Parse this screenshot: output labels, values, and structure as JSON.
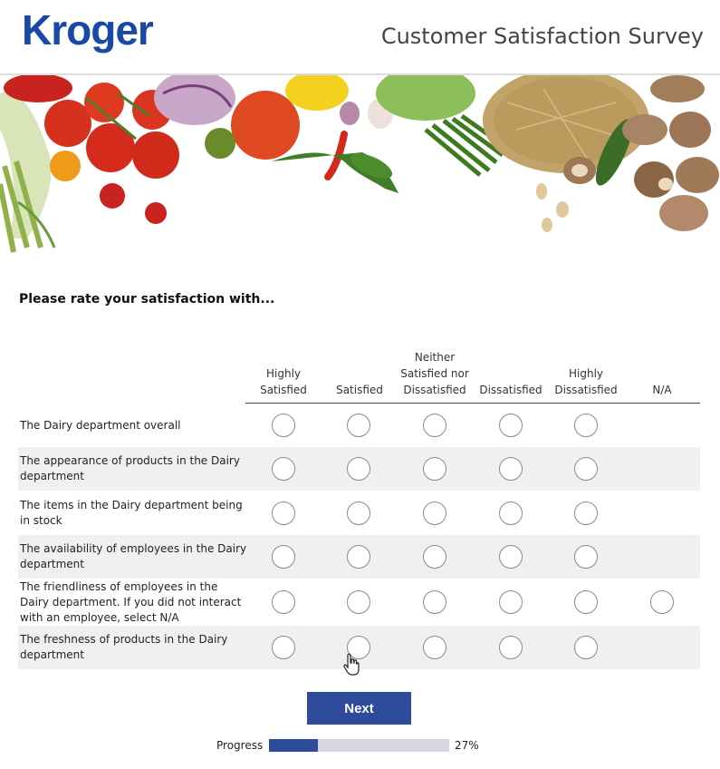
{
  "header": {
    "logo_text": "Kroger",
    "title": "Customer Satisfaction Survey",
    "brand_color": "#1a48a8"
  },
  "question": {
    "prompt": "Please rate your satisfaction with..."
  },
  "columns": [
    "Highly Satisfied",
    "Satisfied",
    "Neither Satisfied nor Dissatisfied",
    "Dissatisfied",
    "Highly Dissatisfied",
    "N/A"
  ],
  "rows": [
    {
      "label": "The Dairy department overall",
      "has_na": false
    },
    {
      "label": "The appearance of products in the Dairy department",
      "has_na": false
    },
    {
      "label": "The items in the Dairy department being in stock",
      "has_na": false
    },
    {
      "label": "The availability of employees in the Dairy department",
      "has_na": false
    },
    {
      "label": "The friendliness of employees in the Dairy department. If you did not interact with an employee, select N/A",
      "has_na": true
    },
    {
      "label": "The freshness of products in the Dairy department",
      "has_na": false
    }
  ],
  "next_label": "Next",
  "progress": {
    "label": "Progress",
    "value": 0.27,
    "percent_text": "27%",
    "color": "#2e4b9b"
  }
}
